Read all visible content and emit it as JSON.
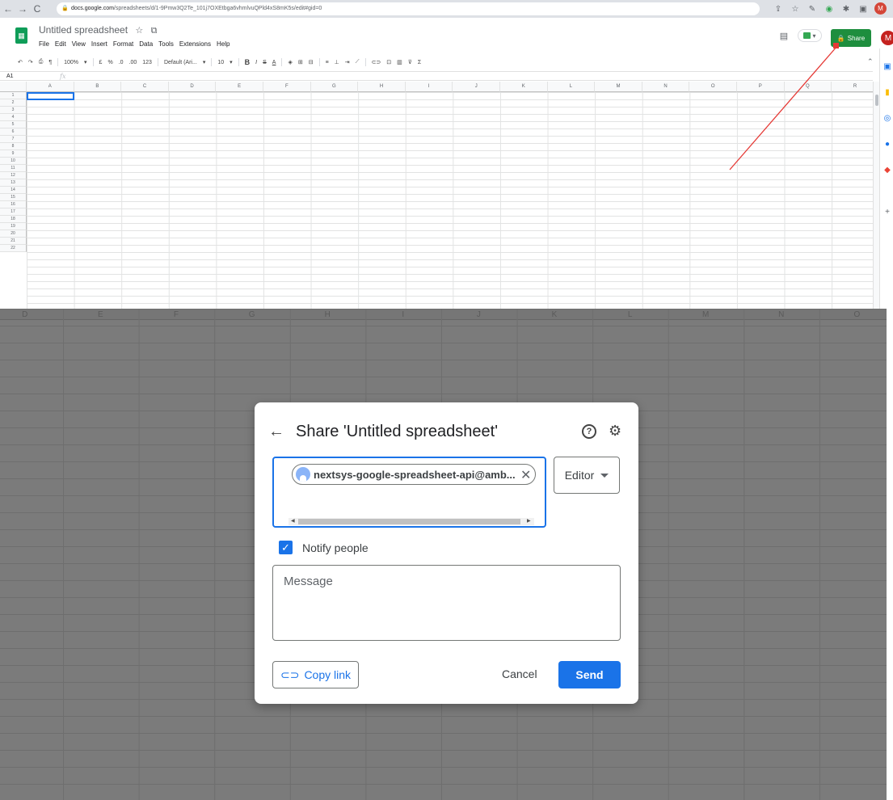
{
  "browser": {
    "url_host": "docs.google.com",
    "url_path": "/spreadsheets/d/1-9Pmw3Q2Te_101j7OXEtbga6vhmlvuQPld4xS8mK5s/edit#gid=0",
    "profile_initial": "M"
  },
  "sheets": {
    "doc_title": "Untitled spreadsheet",
    "menu": [
      "File",
      "Edit",
      "View",
      "Insert",
      "Format",
      "Data",
      "Tools",
      "Extensions",
      "Help"
    ],
    "share_label": "Share",
    "avatar_initial": "M",
    "toolbar": {
      "zoom": "100%",
      "currency": "£",
      "percent": "%",
      "dec_less": ".0",
      "dec_more": ".00",
      "format": "123",
      "font": "Default (Ari...",
      "font_size": "10"
    },
    "name_box": "A1",
    "fx": "fx",
    "columns": [
      "A",
      "B",
      "C",
      "D",
      "E",
      "F",
      "G",
      "H",
      "I",
      "J",
      "K",
      "L",
      "M",
      "N",
      "O",
      "P",
      "Q",
      "R"
    ],
    "rows": [
      "1",
      "2",
      "3",
      "4",
      "5",
      "6",
      "7",
      "8",
      "9",
      "10",
      "11",
      "12",
      "13",
      "14",
      "15",
      "16",
      "17",
      "18",
      "19",
      "20",
      "21",
      "22"
    ]
  },
  "background_columns": [
    "D",
    "E",
    "F",
    "G",
    "H",
    "I",
    "J",
    "K",
    "L",
    "M",
    "N",
    "O"
  ],
  "annotation": {
    "color": "#e53935",
    "target": "share-button"
  },
  "dialog": {
    "title": "Share 'Untitled spreadsheet'",
    "chip_email": "nextsys-google-spreadsheet-api@amb...",
    "role": "Editor",
    "notify_label": "Notify people",
    "notify_checked": true,
    "message_placeholder": "Message",
    "copy_link_label": "Copy link",
    "cancel_label": "Cancel",
    "send_label": "Send"
  },
  "colors": {
    "accent": "#1a73e8",
    "share_green": "#1e8e3e",
    "sheets_green": "#0f9d58"
  }
}
